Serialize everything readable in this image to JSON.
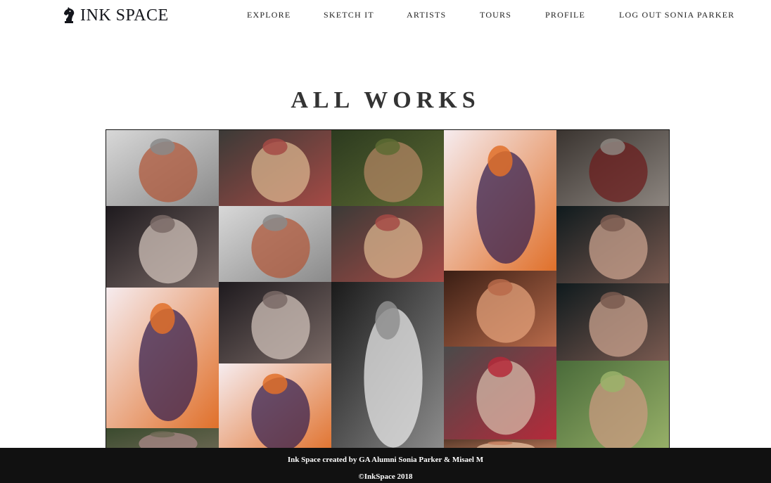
{
  "brand": {
    "name": "INK SPACE",
    "icon": "chess-knight-icon",
    "color": "#14161c"
  },
  "nav": {
    "items": [
      {
        "label": "EXPLORE"
      },
      {
        "label": "SKETCH IT"
      },
      {
        "label": "ARTISTS"
      },
      {
        "label": "TOURS"
      },
      {
        "label": "PROFILE"
      },
      {
        "label": "LOG OUT SONIA PARKER"
      }
    ]
  },
  "main": {
    "title": "ALL WORKS"
  },
  "gallery": {
    "photos": [
      {
        "subject": "tattooed-arm-holding-cup",
        "palette": [
          "#d8d8d8",
          "#8a8a8a",
          "#b0593c"
        ]
      },
      {
        "subject": "red-hair-shoulder-tattoo",
        "palette": [
          "#3b3a37",
          "#a54a45",
          "#d9b48e"
        ]
      },
      {
        "subject": "woman-in-lily-pond",
        "palette": [
          "#2c3a1f",
          "#5d6b33",
          "#b08462"
        ]
      },
      {
        "subject": "purple-hair-woman-sunset",
        "palette": [
          "#f6ecef",
          "#e0702a",
          "#3a2350"
        ]
      },
      {
        "subject": "tattooed-hands-rings",
        "palette": [
          "#3a3430",
          "#8d8680",
          "#6b1d1d"
        ]
      },
      {
        "subject": "tattooed-man-dark",
        "palette": [
          "#1e1a1e",
          "#7a6a66",
          "#cfc0b8"
        ]
      },
      {
        "subject": "tattooed-arm-holding-cup",
        "palette": [
          "#d8d8d8",
          "#8a8a8a",
          "#b0593c"
        ]
      },
      {
        "subject": "red-hair-shoulder-tattoo",
        "palette": [
          "#3b3a37",
          "#a54a45",
          "#d9b48e"
        ]
      },
      {
        "subject": "tattooed-hands-on-face",
        "palette": [
          "#0f1a1d",
          "#7a5a50",
          "#c9a28e"
        ]
      },
      {
        "subject": "purple-hair-woman-sunset",
        "palette": [
          "#f6ecef",
          "#e0702a",
          "#3a2350"
        ]
      },
      {
        "subject": "tattooed-man-dark",
        "palette": [
          "#1e1a1e",
          "#7a6a66",
          "#cfc0b8"
        ]
      },
      {
        "subject": "tattooed-man-black-and-white",
        "palette": [
          "#1a1a1a",
          "#8f8f8f",
          "#e8e8e8"
        ]
      },
      {
        "subject": "henna-palms",
        "palette": [
          "#3a1e14",
          "#b86a4a",
          "#e3a07a"
        ]
      },
      {
        "subject": "tattooed-hands-on-face",
        "palette": [
          "#0f1a1d",
          "#7a5a50",
          "#c9a28e"
        ]
      },
      {
        "subject": "plaid-skirt-tattooed-leg",
        "palette": [
          "#4a4a4a",
          "#b52a3a",
          "#d6b9a8"
        ]
      },
      {
        "subject": "purple-hair-woman-sunset",
        "palette": [
          "#f6ecef",
          "#e0702a",
          "#3a2350"
        ]
      },
      {
        "subject": "tattooed-arm-greenery",
        "palette": [
          "#4a6b3a",
          "#9ab36a",
          "#c99a80"
        ]
      },
      {
        "subject": "tattooed-forest-partial",
        "palette": [
          "#3a4a2e",
          "#6f6a55",
          "#a88"
        ]
      },
      {
        "subject": "henna-palms-partial",
        "palette": [
          "#5a3a2a",
          "#c47e5e",
          "#e8c0a0"
        ]
      }
    ]
  },
  "footer": {
    "credit": "Ink Space created by GA Alumni Sonia Parker & Misael M",
    "copyright": "©InkSpace 2018"
  }
}
